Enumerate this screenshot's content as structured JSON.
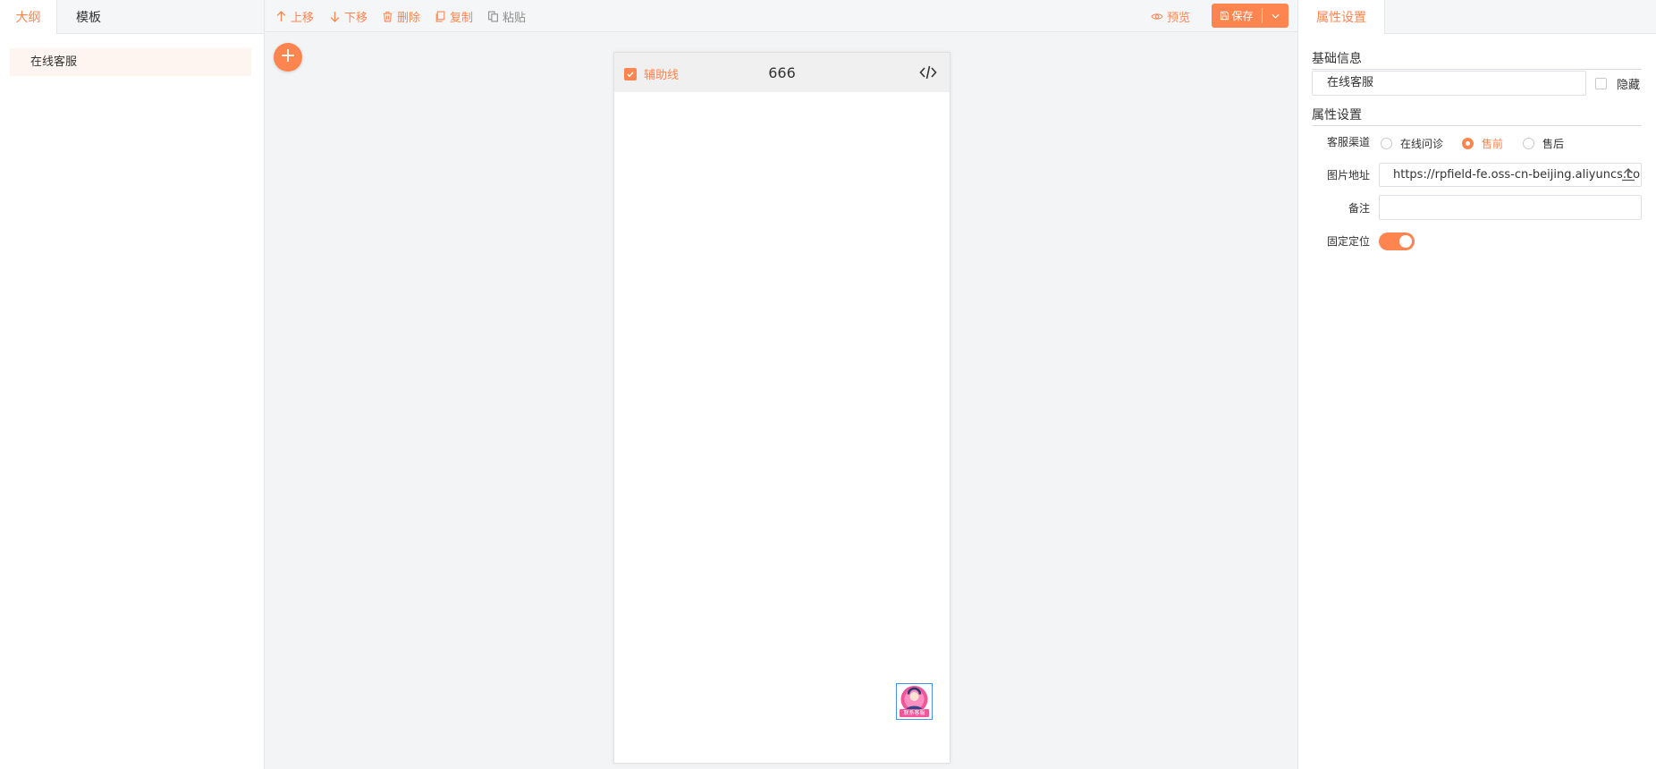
{
  "left_panel": {
    "tabs": [
      {
        "label": "大纲",
        "active": true
      },
      {
        "label": "模板",
        "active": false
      }
    ],
    "outline_items": [
      "在线客服"
    ]
  },
  "toolbar": {
    "move_up": "上移",
    "move_down": "下移",
    "delete": "删除",
    "copy": "复制",
    "paste": "粘贴",
    "preview": "预览",
    "save": "保存"
  },
  "canvas": {
    "add_icon": "+",
    "guide_label": "辅助线",
    "guide_checked": true,
    "page_title": "666",
    "widget_badge": "联系客服"
  },
  "right_panel": {
    "tab": "属性设置",
    "basic_section": "基础信息",
    "component_name": "在线客服",
    "hide_label": "隐藏",
    "hide_checked": false,
    "props_section": "属性设置",
    "channel_label": "客服渠道",
    "channels": [
      {
        "label": "在线问诊",
        "selected": false
      },
      {
        "label": "售前",
        "selected": true
      },
      {
        "label": "售后",
        "selected": false
      }
    ],
    "image_label": "图片地址",
    "image_url": "https://rpfield-fe.oss-cn-beijing.aliyuncs.com/",
    "note_label": "备注",
    "note_value": "",
    "fixed_label": "固定定位",
    "fixed_on": true
  },
  "colors": {
    "accent": "#ff8550",
    "disabled": "#8c8c8c",
    "panel_bg": "#f5f6f7",
    "canvas_bg": "#f3f4f5"
  },
  "icons": [
    "arrow-up-icon",
    "arrow-down-icon",
    "trash-icon",
    "copy-icon",
    "paste-icon",
    "eye-icon",
    "save-icon",
    "chevron-down-icon",
    "plus-icon",
    "check-icon",
    "code-icon",
    "upload-icon"
  ]
}
